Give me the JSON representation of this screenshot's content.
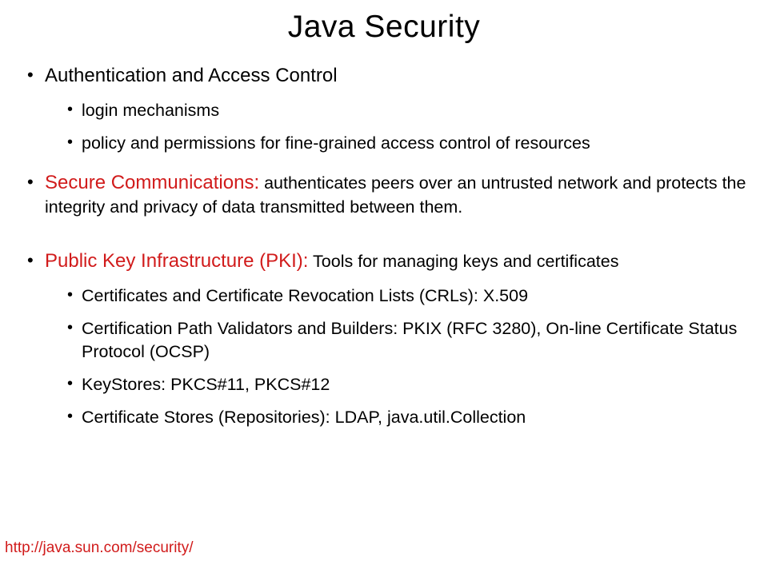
{
  "title": "Java Security",
  "items": [
    {
      "text": "Authentication and Access Control",
      "sub": [
        {
          "text": "login mechanisms"
        },
        {
          "text": "policy and permissions for fine-grained access control of resources"
        }
      ]
    },
    {
      "label": "Secure Communications:",
      "cont": " authenticates peers over an untrusted network and protects the integrity and privacy of data transmitted between them."
    },
    {
      "label": "Public Key Infrastructure (PKI):",
      "cont": " Tools for managing keys and certificates",
      "sub": [
        {
          "text": "Certificates and Certificate Revocation Lists (CRLs): X.509"
        },
        {
          "text": "Certification Path Validators and Builders: PKIX (RFC 3280), On-line Certificate Status Protocol (OCSP)"
        },
        {
          "text": "KeyStores: PKCS#11, PKCS#12"
        },
        {
          "text": "Certificate Stores (Repositories): LDAP, java.util.Collection"
        }
      ]
    }
  ],
  "footer_link": "http://java.sun.com/security/"
}
